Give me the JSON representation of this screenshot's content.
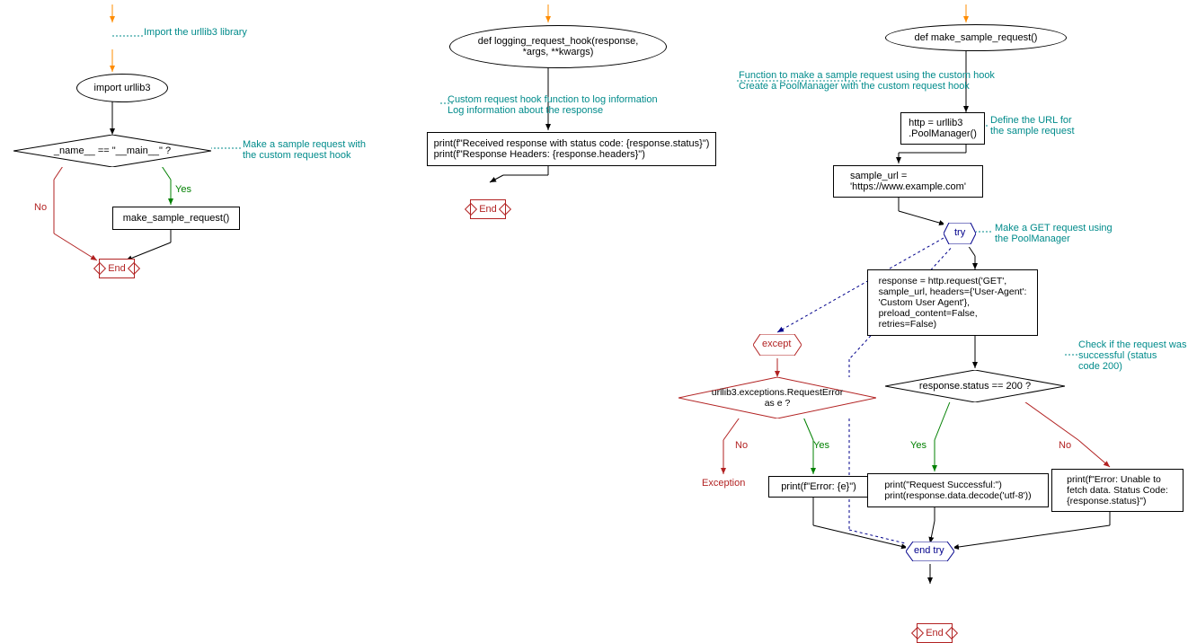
{
  "flow1": {
    "comment_import": "Import the urllib3 library",
    "import_stmt": "import urllib3",
    "main_check": "_name__ == \"__main__\" ?",
    "comment_main": "Make a sample request with\nthe custom request hook",
    "call_main": "make_sample_request()",
    "yes": "Yes",
    "no": "No",
    "end": "End"
  },
  "flow2": {
    "def": "def logging_request_hook(response,\n*args, **kwargs)",
    "comment": "Custom request hook function to log information\nLog information about the response",
    "body": "print(f\"Received response with status code: {response.status}\")\nprint(f\"Response Headers: {response.headers}\")",
    "end": "End"
  },
  "flow3": {
    "def": "def make_sample_request()",
    "comment_func": "Function to make a sample request using the custom hook\nCreate a PoolManager with the custom request hook",
    "poolmgr": "http = urllib3\n.PoolManager()",
    "comment_url": "Define the URL for\nthe sample request",
    "url": "sample_url =\n'https://www.example.com'",
    "try": "try",
    "comment_get": "Make a GET request using\nthe PoolManager",
    "response": "response = http.request('GET',\nsample_url, headers={'User-Agent':\n'Custom User Agent'},\npreload_content=False,\nretries=False)",
    "comment_check": "Check if the request was\nsuccessful (status\ncode 200)",
    "status_check": "response.status == 200 ?",
    "except": "except",
    "except_check": "urllib3.exceptions.RequestError\nas e ?",
    "success": "print(\"Request Successful:\")\nprint(response.data.decode('utf-8'))",
    "fail": "print(f\"Error: Unable to\nfetch data. Status Code:\n{response.status}\")",
    "error": "print(f\"Error: {e}\")",
    "exception": "Exception",
    "endtry": "end try",
    "end": "End",
    "yes": "Yes",
    "no": "No"
  }
}
